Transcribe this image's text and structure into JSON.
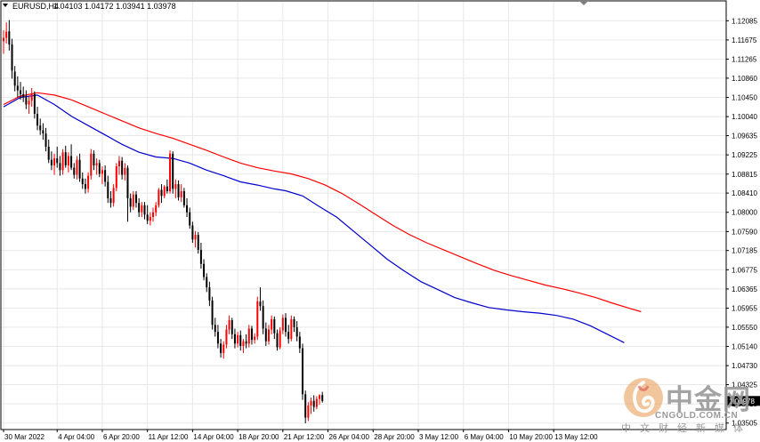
{
  "header": {
    "symbol": "EURUSD,H4",
    "ohlc": "1.04103 1.04172 1.03941 1.03978",
    "current_price": "1.03978"
  },
  "colors": {
    "bull": "#ff0000",
    "bear": "#000000",
    "ma_fast": "#0000cd",
    "ma_slow": "#ff0000",
    "grid": "#e8e8e8",
    "axis": "#000000",
    "price_tag_bg": "#000000"
  },
  "watermark": {
    "name": "中金网",
    "domain": "CNGOLD.COM.CN",
    "sub": "中文财经新媒体"
  },
  "chart_data": {
    "type": "candlestick",
    "xlabel": "",
    "ylabel": "",
    "ylim": [
      1.035,
      1.123
    ],
    "y_ticks": [
      "1.12085",
      "1.11675",
      "1.11265",
      "1.10860",
      "1.10450",
      "1.10040",
      "1.09635",
      "1.09225",
      "1.08815",
      "1.08410",
      "1.08000",
      "1.07590",
      "1.07185",
      "1.06775",
      "1.06365",
      "1.05955",
      "1.05550",
      "1.05140",
      "1.04730",
      "1.04325",
      "1.03915",
      "1.03505"
    ],
    "x_ticks": [
      {
        "label": "30 Mar 2022",
        "bar": 0
      },
      {
        "label": "4 Apr 04:00",
        "bar": 19
      },
      {
        "label": "6 Apr 20:00",
        "bar": 35
      },
      {
        "label": "11 Apr 12:00",
        "bar": 51
      },
      {
        "label": "14 Apr 04:00",
        "bar": 67
      },
      {
        "label": "18 Apr 20:00",
        "bar": 83
      },
      {
        "label": "21 Apr 12:00",
        "bar": 99
      },
      {
        "label": "26 Apr 04:00",
        "bar": 115
      },
      {
        "label": "28 Apr 20:00",
        "bar": 131
      },
      {
        "label": "3 May 12:00",
        "bar": 147
      },
      {
        "label": "6 May 04:00",
        "bar": 163
      },
      {
        "label": "10 May 20:00",
        "bar": 179
      },
      {
        "label": "13 May 12:00",
        "bar": 195
      }
    ],
    "grid": true,
    "series": [
      {
        "name": "EURUSD,H4",
        "type": "candlestick",
        "ohlc": [
          [
            1.1165,
            1.1188,
            1.1138,
            1.1172
          ],
          [
            1.1172,
            1.1205,
            1.116,
            1.1185
          ],
          [
            1.1186,
            1.121,
            1.1145,
            1.1158
          ],
          [
            1.1158,
            1.117,
            1.1085,
            1.1102
          ],
          [
            1.11,
            1.1112,
            1.1058,
            1.107
          ],
          [
            1.107,
            1.109,
            1.1045,
            1.106
          ],
          [
            1.106,
            1.1078,
            1.104,
            1.1052
          ],
          [
            1.1052,
            1.1068,
            1.1035,
            1.1045
          ],
          [
            1.1045,
            1.106,
            1.102,
            1.103
          ],
          [
            1.103,
            1.1048,
            1.101,
            1.1038
          ],
          [
            1.1038,
            1.1065,
            1.1025,
            1.1052
          ],
          [
            1.1052,
            1.1058,
            1.1,
            1.101
          ],
          [
            1.101,
            1.1025,
            1.0975,
            1.0985
          ],
          [
            1.0985,
            1.1,
            1.0965,
            1.0975
          ],
          [
            1.0975,
            1.099,
            1.0955,
            1.0968
          ],
          [
            1.0968,
            1.098,
            1.093,
            1.094
          ],
          [
            1.094,
            1.0955,
            1.0905,
            1.0912
          ],
          [
            1.0912,
            1.093,
            1.089,
            1.09
          ],
          [
            1.09,
            1.0925,
            1.088,
            1.0915
          ],
          [
            1.0915,
            1.094,
            1.0895,
            1.0905
          ],
          [
            1.0905,
            1.092,
            1.0878,
            1.089
          ],
          [
            1.089,
            1.0935,
            1.088,
            1.0928
          ],
          [
            1.0928,
            1.0942,
            1.0895,
            1.09
          ],
          [
            1.09,
            1.0928,
            1.0885,
            1.092
          ],
          [
            1.092,
            1.0945,
            1.089,
            1.0895
          ],
          [
            1.0895,
            1.0905,
            1.0872,
            1.088
          ],
          [
            1.088,
            1.092,
            1.087,
            1.0912
          ],
          [
            1.0912,
            1.0925,
            1.0865,
            1.0872
          ],
          [
            1.0872,
            1.0885,
            1.085,
            1.086
          ],
          [
            1.086,
            1.0872,
            1.084,
            1.085
          ],
          [
            1.085,
            1.0885,
            1.0842,
            1.0878
          ],
          [
            1.0878,
            1.0935,
            1.087,
            1.0925
          ],
          [
            1.0925,
            1.0932,
            1.089,
            1.09
          ],
          [
            1.09,
            1.0915,
            1.088,
            1.0905
          ],
          [
            1.0905,
            1.0912,
            1.0875,
            1.0882
          ],
          [
            1.0882,
            1.0898,
            1.086,
            1.089
          ],
          [
            1.089,
            1.09,
            1.0855,
            1.0865
          ],
          [
            1.0865,
            1.0878,
            1.082,
            1.083
          ],
          [
            1.083,
            1.0845,
            1.081,
            1.082
          ],
          [
            1.082,
            1.086,
            1.0812,
            1.0852
          ],
          [
            1.0852,
            1.0905,
            1.0845,
            1.0898
          ],
          [
            1.0898,
            1.092,
            1.088,
            1.091
          ],
          [
            1.091,
            1.0918,
            1.087,
            1.088
          ],
          [
            1.088,
            1.0905,
            1.0868,
            1.0895
          ],
          [
            1.0895,
            1.09,
            1.078,
            1.083
          ],
          [
            1.083,
            1.084,
            1.08,
            1.0812
          ],
          [
            1.0812,
            1.0845,
            1.0805,
            1.0838
          ],
          [
            1.0838,
            1.0845,
            1.081,
            1.082
          ],
          [
            1.082,
            1.083,
            1.079,
            1.08
          ],
          [
            1.08,
            1.0822,
            1.079,
            1.0815
          ],
          [
            1.0815,
            1.0822,
            1.0785,
            1.0795
          ],
          [
            1.0795,
            1.0815,
            1.0775,
            1.0782
          ],
          [
            1.0782,
            1.08,
            1.0772,
            1.079
          ],
          [
            1.079,
            1.081,
            1.078,
            1.08
          ],
          [
            1.08,
            1.0822,
            1.0792,
            1.0815
          ],
          [
            1.0815,
            1.0852,
            1.081,
            1.0848
          ],
          [
            1.0848,
            1.086,
            1.082,
            1.0835
          ],
          [
            1.0835,
            1.0858,
            1.083,
            1.0855
          ],
          [
            1.0855,
            1.087,
            1.084,
            1.0845
          ],
          [
            1.0845,
            1.0932,
            1.084,
            1.0925
          ],
          [
            1.0925,
            1.093,
            1.084,
            1.085
          ],
          [
            1.085,
            1.087,
            1.083,
            1.086
          ],
          [
            1.086,
            1.0868,
            1.0825,
            1.0832
          ],
          [
            1.0832,
            1.086,
            1.0822,
            1.0845
          ],
          [
            1.0845,
            1.0852,
            1.081,
            1.0815
          ],
          [
            1.0815,
            1.083,
            1.079,
            1.08
          ],
          [
            1.08,
            1.081,
            1.0765,
            1.0772
          ],
          [
            1.0772,
            1.078,
            1.0735,
            1.0742
          ],
          [
            1.0742,
            1.076,
            1.0725,
            1.0752
          ],
          [
            1.0752,
            1.0758,
            1.0712,
            1.072
          ],
          [
            1.072,
            1.0735,
            1.068,
            1.069
          ],
          [
            1.069,
            1.07,
            1.0655,
            1.0662
          ],
          [
            1.0662,
            1.067,
            1.063,
            1.064
          ],
          [
            1.064,
            1.0652,
            1.06,
            1.0612
          ],
          [
            1.0612,
            1.062,
            1.055,
            1.056
          ],
          [
            1.056,
            1.0575,
            1.0535,
            1.0545
          ],
          [
            1.0545,
            1.056,
            1.051,
            1.052
          ],
          [
            1.052,
            1.053,
            1.049,
            1.05
          ],
          [
            1.05,
            1.0525,
            1.0488,
            1.0518
          ],
          [
            1.0518,
            1.056,
            1.051,
            1.055
          ],
          [
            1.055,
            1.058,
            1.054,
            1.057
          ],
          [
            1.057,
            1.0575,
            1.053,
            1.054
          ],
          [
            1.054,
            1.0552,
            1.051,
            1.052
          ],
          [
            1.052,
            1.0545,
            1.0512,
            1.0538
          ],
          [
            1.0538,
            1.0548,
            1.0505,
            1.0515
          ],
          [
            1.0515,
            1.053,
            1.05,
            1.0525
          ],
          [
            1.0525,
            1.054,
            1.051,
            1.052
          ],
          [
            1.052,
            1.056,
            1.0512,
            1.0552
          ],
          [
            1.0552,
            1.0558,
            1.0518,
            1.0528
          ],
          [
            1.0528,
            1.0542,
            1.052,
            1.0535
          ],
          [
            1.0535,
            1.062,
            1.0528,
            1.061
          ],
          [
            1.061,
            1.064,
            1.059,
            1.06
          ],
          [
            1.06,
            1.0612,
            1.054,
            1.0552
          ],
          [
            1.0552,
            1.0565,
            1.0515,
            1.0525
          ],
          [
            1.0525,
            1.056,
            1.0518,
            1.055
          ],
          [
            1.055,
            1.058,
            1.054,
            1.0572
          ],
          [
            1.0572,
            1.0578,
            1.053,
            1.0542
          ],
          [
            1.0542,
            1.055,
            1.0505,
            1.0512
          ],
          [
            1.0512,
            1.0555,
            1.0508,
            1.0548
          ],
          [
            1.0548,
            1.0582,
            1.054,
            1.0575
          ],
          [
            1.0575,
            1.0585,
            1.0535,
            1.0545
          ],
          [
            1.0545,
            1.056,
            1.052,
            1.053
          ],
          [
            1.053,
            1.058,
            1.0525,
            1.0572
          ],
          [
            1.0572,
            1.0578,
            1.0545,
            1.0555
          ],
          [
            1.0555,
            1.0568,
            1.0525,
            1.0535
          ],
          [
            1.0535,
            1.0545,
            1.05,
            1.051
          ],
          [
            1.051,
            1.052,
            1.04,
            1.0412
          ],
          [
            1.0412,
            1.042,
            1.035,
            1.0362
          ],
          [
            1.0362,
            1.0395,
            1.0355,
            1.0388
          ],
          [
            1.0388,
            1.0405,
            1.037,
            1.0398
          ],
          [
            1.0398,
            1.041,
            1.0375,
            1.0385
          ],
          [
            1.0385,
            1.0408,
            1.038,
            1.0402
          ],
          [
            1.0402,
            1.0412,
            1.039,
            1.041
          ],
          [
            1.04103,
            1.04172,
            1.03941,
            1.03978
          ]
        ]
      },
      {
        "name": "",
        "type": "line",
        "points": [
          [
            0,
            1.1025
          ],
          [
            6,
            1.1045
          ],
          [
            12,
            1.105
          ],
          [
            18,
            1.103
          ],
          [
            24,
            1.1005
          ],
          [
            30,
            1.0985
          ],
          [
            36,
            1.0965
          ],
          [
            42,
            1.0945
          ],
          [
            48,
            1.0928
          ],
          [
            54,
            1.0918
          ],
          [
            60,
            1.0915
          ],
          [
            66,
            1.0905
          ],
          [
            72,
            1.089
          ],
          [
            78,
            1.0878
          ],
          [
            84,
            1.0865
          ],
          [
            90,
            1.0858
          ],
          [
            96,
            1.085
          ],
          [
            100,
            1.0846
          ],
          [
            106,
            1.0835
          ],
          [
            112,
            1.0812
          ],
          [
            118,
            1.079
          ],
          [
            124,
            1.076
          ],
          [
            130,
            1.073
          ],
          [
            136,
            1.07
          ],
          [
            142,
            1.0675
          ],
          [
            148,
            1.0652
          ],
          [
            154,
            1.0635
          ],
          [
            160,
            1.0618
          ],
          [
            166,
            1.0607
          ],
          [
            172,
            1.0597
          ],
          [
            178,
            1.0592
          ],
          [
            184,
            1.0588
          ],
          [
            190,
            1.0585
          ],
          [
            196,
            1.058
          ],
          [
            202,
            1.0572
          ],
          [
            208,
            1.0558
          ],
          [
            214,
            1.054
          ],
          [
            220,
            1.0522
          ]
        ]
      },
      {
        "name": "",
        "type": "line",
        "points": [
          [
            0,
            1.103
          ],
          [
            6,
            1.1048
          ],
          [
            12,
            1.1055
          ],
          [
            18,
            1.105
          ],
          [
            24,
            1.104
          ],
          [
            30,
            1.1025
          ],
          [
            36,
            1.101
          ],
          [
            42,
            1.0995
          ],
          [
            48,
            1.098
          ],
          [
            54,
            1.0968
          ],
          [
            60,
            1.0958
          ],
          [
            66,
            1.0945
          ],
          [
            72,
            1.0932
          ],
          [
            78,
            1.0918
          ],
          [
            84,
            1.0905
          ],
          [
            90,
            1.0895
          ],
          [
            96,
            1.0888
          ],
          [
            102,
            1.0882
          ],
          [
            108,
            1.0872
          ],
          [
            114,
            1.0858
          ],
          [
            120,
            1.084
          ],
          [
            126,
            1.0818
          ],
          [
            132,
            1.0795
          ],
          [
            138,
            1.0772
          ],
          [
            144,
            1.0752
          ],
          [
            150,
            1.0735
          ],
          [
            156,
            1.072
          ],
          [
            162,
            1.0705
          ],
          [
            168,
            1.069
          ],
          [
            174,
            1.0676
          ],
          [
            180,
            1.0665
          ],
          [
            186,
            1.0655
          ],
          [
            192,
            1.0645
          ],
          [
            198,
            1.0637
          ],
          [
            204,
            1.0628
          ],
          [
            210,
            1.0618
          ],
          [
            216,
            1.0606
          ],
          [
            222,
            1.0595
          ],
          [
            226,
            1.0588
          ]
        ]
      }
    ]
  }
}
